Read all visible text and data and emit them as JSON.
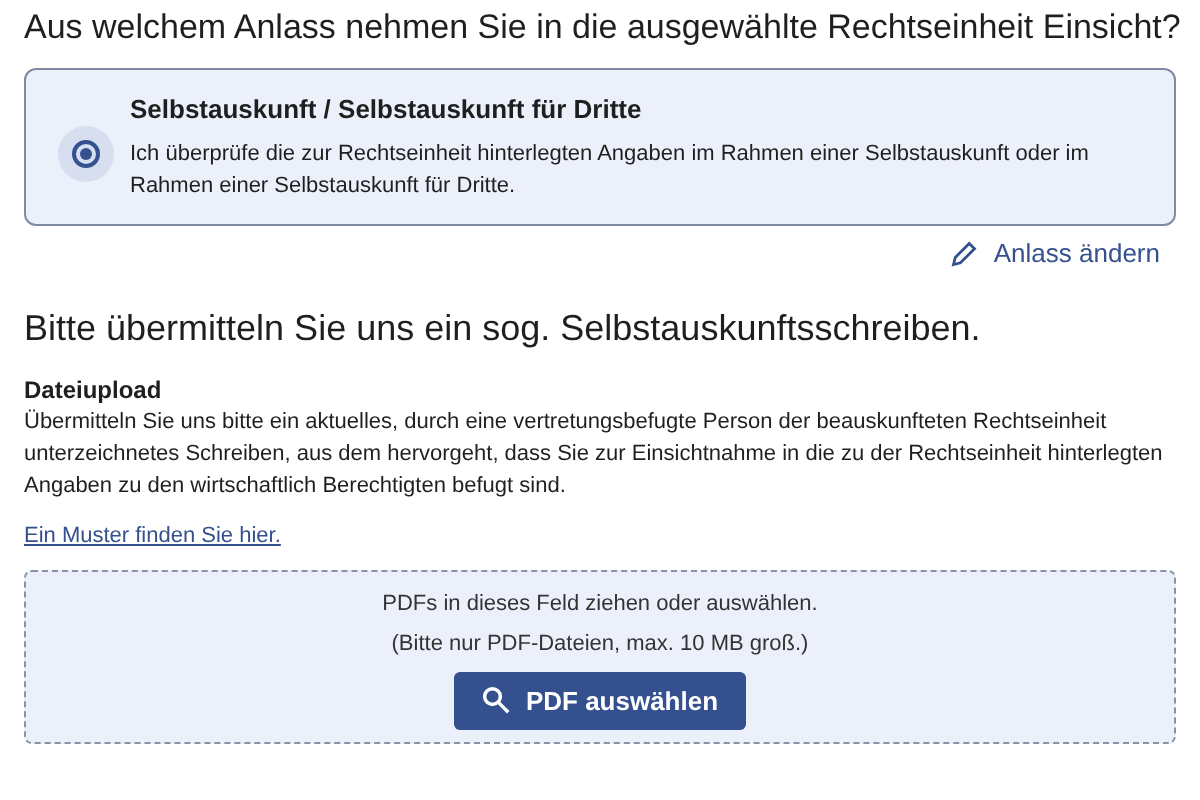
{
  "question": "Aus welchem Anlass nehmen Sie in die ausgewählte Rechtseinheit Einsicht?",
  "options": [
    {
      "title": "Selbstauskunft / Selbstauskunft für Dritte",
      "description": "Ich überprüfe die zur Rechtseinheit hinterlegten Angaben im Rahmen einer Selbstauskunft oder im Rahmen einer Selbstauskunft für Dritte.",
      "selected": true
    }
  ],
  "change_link": "Anlass ändern",
  "section_title": "Bitte übermitteln Sie uns ein sog. Selbstauskunftsschreiben.",
  "upload": {
    "label": "Dateiupload",
    "description": "Übermitteln Sie uns bitte ein aktuelles, durch eine vertretungsbefugte Person der beauskunfteten Rechtseinheit unterzeichnetes Schreiben, aus dem hervorgeht, dass Sie zur Einsichtnahme in die zu der Rechtseinheit hinterlegten Angaben zu den wirtschaftlich Berechtigten befugt sind.",
    "sample_link": "Ein Muster finden Sie hier.",
    "drop_hint": "PDFs in dieses Feld ziehen oder auswählen.",
    "limits": "(Bitte nur PDF-Dateien, max. 10 MB groß.)",
    "button": "PDF auswählen"
  }
}
